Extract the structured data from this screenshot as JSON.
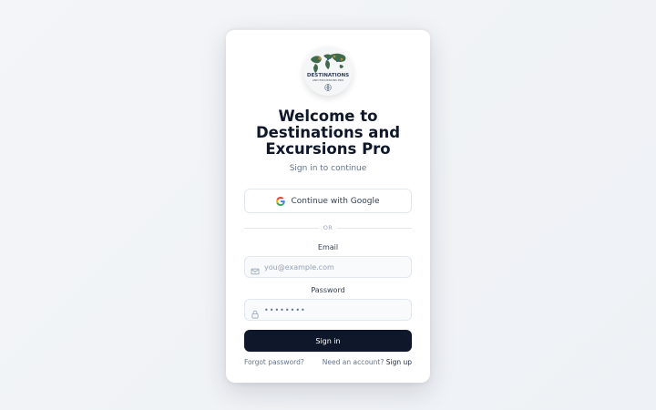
{
  "logo": {
    "name": "DESTINATIONS",
    "tagline": "AND EXCURSIONS PRO"
  },
  "heading": {
    "title": "Welcome to Destinations and Excursions Pro",
    "subtitle": "Sign in to continue"
  },
  "oauth": {
    "google_label": "Continue with Google",
    "icon": "google-icon"
  },
  "divider": {
    "text": "OR"
  },
  "form": {
    "email_label": "Email",
    "email_placeholder": "you@example.com",
    "email_icon": "mail-icon",
    "password_label": "Password",
    "password_value": "••••••••",
    "password_icon": "lock-icon",
    "submit_label": "Sign in"
  },
  "footer": {
    "forgot": "Forgot password?",
    "no_account": "Need an account?",
    "signup": "Sign up"
  },
  "colors": {
    "primary": "#0f172a",
    "muted": "#64748b",
    "border": "#e2e8f0",
    "background": "#f3f5f8"
  }
}
